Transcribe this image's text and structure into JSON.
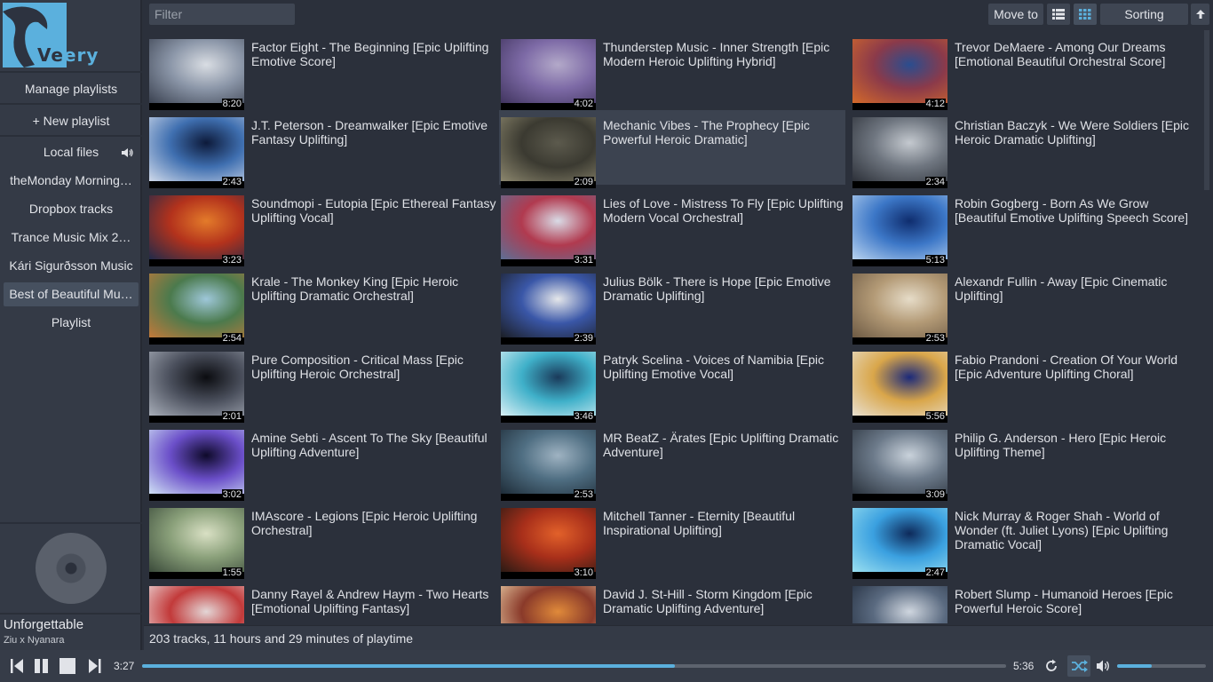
{
  "app": {
    "logo_text_main": "Ve",
    "logo_text_ext": "ery",
    "accent": "#5bb0dd"
  },
  "sidebar": {
    "manage_playlists": "Manage playlists",
    "new_playlist": "+ New playlist",
    "playlists": [
      {
        "label": "Local files",
        "icon": "speaker-icon"
      },
      {
        "label": "theMonday Morning…"
      },
      {
        "label": "Dropbox tracks"
      },
      {
        "label": "Trance Music Mix 2…"
      },
      {
        "label": "Kári Sigurðsson Music"
      },
      {
        "label": "Best of Beautiful Mu…",
        "active": true
      },
      {
        "label": "Playlist"
      }
    ]
  },
  "now_playing": {
    "title": "Unforgettable",
    "artist": "Ziu x Nyanara"
  },
  "toolbar": {
    "filter_placeholder": "Filter",
    "move_to": "Move to",
    "sorting": "Sorting"
  },
  "tracks": [
    {
      "title": "Factor Eight - The Beginning [Epic Uplifting Emotive Score]",
      "duration": "8:20",
      "colors": [
        "#d9dde3",
        "#8b96a8",
        "#3a4150"
      ]
    },
    {
      "title": "Thunderstep Music - Inner Strength [Epic Modern Heroic Uplifting Hybrid]",
      "duration": "4:02",
      "colors": [
        "#b3a9c9",
        "#7d6aa6",
        "#40345e"
      ]
    },
    {
      "title": "Trevor DeMaere - Among Our Dreams [Emotional Beautiful Orchestral Score]",
      "duration": "4:12",
      "colors": [
        "#2a4d8f",
        "#8b3a4a",
        "#d46a2a"
      ]
    },
    {
      "title": "J.T. Peterson - Dreamwalker [Epic Emotive Fantasy Uplifting]",
      "duration": "2:43",
      "colors": [
        "#0d1a3a",
        "#3f6fb0",
        "#cfd9ea"
      ]
    },
    {
      "title": "Mechanic Vibes - The Prophecy [Epic Powerful Heroic Dramatic]",
      "duration": "2:09",
      "colors": [
        "#5c5a4d",
        "#3b3a31",
        "#8c876e"
      ],
      "highlight": true
    },
    {
      "title": "Christian Baczyk - We Were Soldiers [Epic Heroic Dramatic Uplifting]",
      "duration": "2:34",
      "colors": [
        "#c4c9cf",
        "#6f7680",
        "#2c3038"
      ]
    },
    {
      "title": "Soundmopi - Eutopia [Epic Ethereal Fantasy Uplifting Vocal]",
      "duration": "3:23",
      "colors": [
        "#e37b2a",
        "#b3321c",
        "#1f2a4a"
      ]
    },
    {
      "title": "Lies of Love - Mistress To Fly [Epic Uplifting Modern Vocal Orchestral]",
      "duration": "3:31",
      "colors": [
        "#d9dbe6",
        "#b13a4f",
        "#5d6f95"
      ]
    },
    {
      "title": "Robin Gogberg - Born As We Grow [Beautiful Emotive Uplifting Speech Score]",
      "duration": "5:13",
      "colors": [
        "#0f2d6e",
        "#3c77c7",
        "#b9d3f0"
      ]
    },
    {
      "title": "Krale - The Monkey King [Epic Heroic Uplifting Dramatic Orchestral]",
      "duration": "2:54",
      "colors": [
        "#9ec7d9",
        "#4b7a4d",
        "#c2793a"
      ]
    },
    {
      "title": "Julius Bölk - There is Hope [Epic Emotive Dramatic Uplifting]",
      "duration": "2:39",
      "colors": [
        "#e5e7ea",
        "#3a57a8",
        "#1b1e25"
      ]
    },
    {
      "title": "Alexandr Fullin - Away [Epic Cinematic Uplifting]",
      "duration": "2:53",
      "colors": [
        "#e6dcc8",
        "#b39a76",
        "#6d5a44"
      ]
    },
    {
      "title": "Pure Composition - Critical Mass [Epic Uplifting Heroic Orchestral]",
      "duration": "2:01",
      "colors": [
        "#0b0c10",
        "#4a4f5c",
        "#a7adb8"
      ]
    },
    {
      "title": "Patryk Scelina - Voices of Namibia [Epic Uplifting Emotive Vocal]",
      "duration": "3:46",
      "colors": [
        "#1a3a5a",
        "#3fb0c9",
        "#d8f0f5"
      ]
    },
    {
      "title": "Fabio Prandoni - Creation Of Your World [Epic Adventure Uplifting Choral]",
      "duration": "5:56",
      "colors": [
        "#1c2a7a",
        "#d9a64a",
        "#e8e0d0"
      ]
    },
    {
      "title": "Amine Sebti - Ascent To The Sky [Beautiful Uplifting Adventure]",
      "duration": "3:02",
      "colors": [
        "#0e0a2a",
        "#6b4fc9",
        "#cfe0f5"
      ]
    },
    {
      "title": "MR BeatZ - Ärates [Epic Uplifting Dramatic Adventure]",
      "duration": "2:53",
      "colors": [
        "#9fb3c2",
        "#4f6e82",
        "#1e2c38"
      ]
    },
    {
      "title": "Philip G. Anderson - Hero [Epic Heroic Uplifting Theme]",
      "duration": "3:09",
      "colors": [
        "#c9d2db",
        "#6c7a8a",
        "#2a323c"
      ]
    },
    {
      "title": "IMAscore - Legions [Epic Heroic Uplifting Orchestral]",
      "duration": "1:55",
      "colors": [
        "#d9e0c4",
        "#8aa07a",
        "#3a4a3a"
      ]
    },
    {
      "title": "Mitchell Tanner - Eternity [Beautiful Inspirational Uplifting]",
      "duration": "3:10",
      "colors": [
        "#e2612a",
        "#a82f1a",
        "#2a1a14"
      ]
    },
    {
      "title": "Nick Murray & Roger Shah - World of Wonder (ft. Juliet Lyons) [Epic Uplifting Dramatic Vocal]",
      "duration": "2:47",
      "colors": [
        "#0e2a5a",
        "#3aa0e0",
        "#9be0f0"
      ]
    },
    {
      "title": "Danny Rayel & Andrew Haym - Two Hearts [Emotional Uplifting Fantasy]",
      "duration": "",
      "colors": [
        "#e3d6d6",
        "#c23a3a",
        "#f0e8e8"
      ]
    },
    {
      "title": "David J. St-Hill - Storm Kingdom [Epic Dramatic Uplifting Adventure]",
      "duration": "",
      "colors": [
        "#e08a3a",
        "#8a3a2a",
        "#f2d9b0"
      ]
    },
    {
      "title": "Robert Slump - Humanoid Heroes [Epic Powerful Heroic Score]",
      "duration": "",
      "colors": [
        "#cfd6df",
        "#5a6a80",
        "#1e2838"
      ]
    }
  ],
  "status": {
    "summary": "203 tracks, 11 hours and 29 minutes of playtime"
  },
  "player": {
    "time_current": "3:27",
    "time_total": "5:36",
    "progress_fraction": 0.617,
    "volume_fraction": 0.39
  }
}
